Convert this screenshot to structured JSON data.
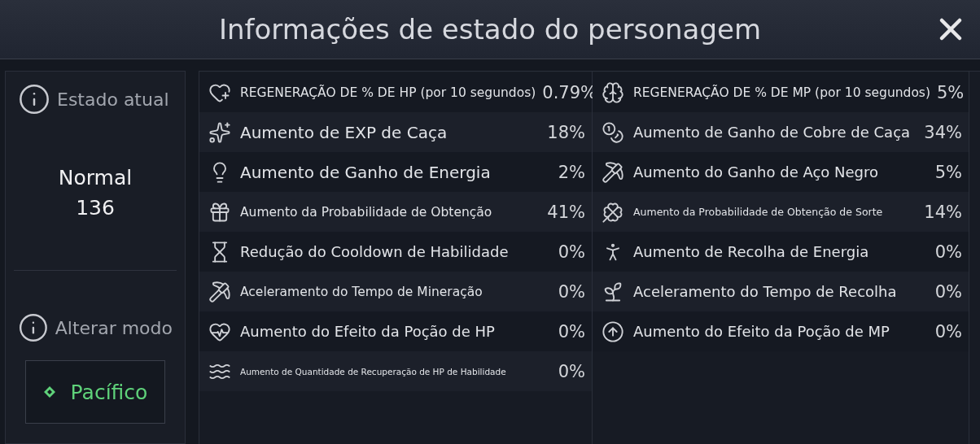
{
  "window": {
    "title": "Informações de estado do personagem"
  },
  "sidebar": {
    "current_label": "Estado atual",
    "state_name": "Normal",
    "state_value": "136",
    "mode_label": "Alterar modo",
    "mode_button": "Pacífico"
  },
  "stats_left": [
    {
      "label": "REGENERAÇÃO DE % DE HP (por 10 segundos)",
      "value": "0.79%"
    },
    {
      "label": "Aumento de EXP de Caça",
      "value": "18%"
    },
    {
      "label": "Aumento de Ganho de Energia",
      "value": "2%"
    },
    {
      "label": "Aumento da Probabilidade de Obtenção",
      "value": "41%"
    },
    {
      "label": "Redução do Cooldown de Habilidade",
      "value": "0%"
    },
    {
      "label": "Aceleramento do Tempo de Mineração",
      "value": "0%"
    },
    {
      "label": "Aumento do Efeito da Poção de HP",
      "value": "0%"
    },
    {
      "label": "Aumento de Quantidade de Recuperação de HP de Habilidade",
      "value": "0%"
    }
  ],
  "stats_right": [
    {
      "label": "REGENERAÇÃO DE % DE MP (por 10 segundos)",
      "value": "5%"
    },
    {
      "label": "Aumento de Ganho de Cobre de Caça",
      "value": "34%"
    },
    {
      "label": "Aumento do Ganho de Aço Negro",
      "value": "5%"
    },
    {
      "label": "Aumento da Probabilidade de Obtenção de Sorte",
      "value": "14%"
    },
    {
      "label": "Aumento de Recolha de Energia",
      "value": "0%"
    },
    {
      "label": "Aceleramento do Tempo de Recolha",
      "value": "0%"
    },
    {
      "label": "Aumento do Efeito da Poção de MP",
      "value": "0%"
    }
  ]
}
